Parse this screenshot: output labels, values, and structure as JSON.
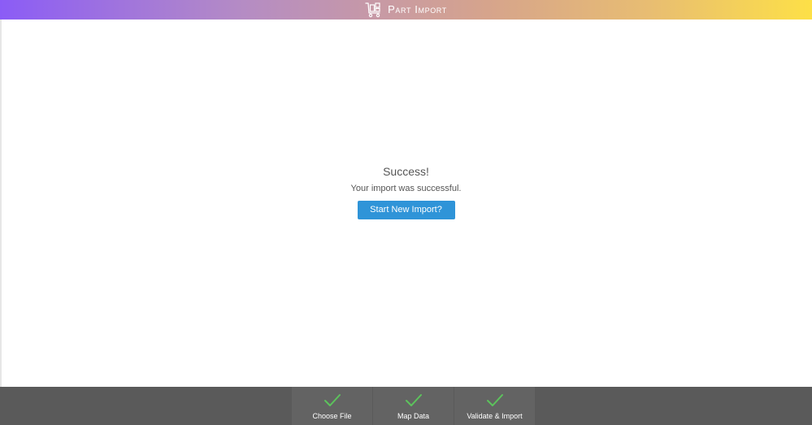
{
  "header": {
    "title": "Part Import",
    "icon": "part-cart-icon",
    "gradient_start": "#8b5cf6",
    "gradient_mid": "#d6a48c",
    "gradient_end": "#fde047"
  },
  "main": {
    "success_title": "Success!",
    "success_message": "Your import was successful.",
    "start_button_label": "Start New Import?",
    "button_color": "#2f94d8"
  },
  "footer": {
    "steps": [
      {
        "label": "Choose File",
        "icon": "checkmark-icon",
        "status": "complete"
      },
      {
        "label": "Map Data",
        "icon": "checkmark-icon",
        "status": "complete"
      },
      {
        "label": "Validate & Import",
        "icon": "checkmark-icon",
        "status": "complete"
      }
    ],
    "check_color": "#5cc35c"
  }
}
